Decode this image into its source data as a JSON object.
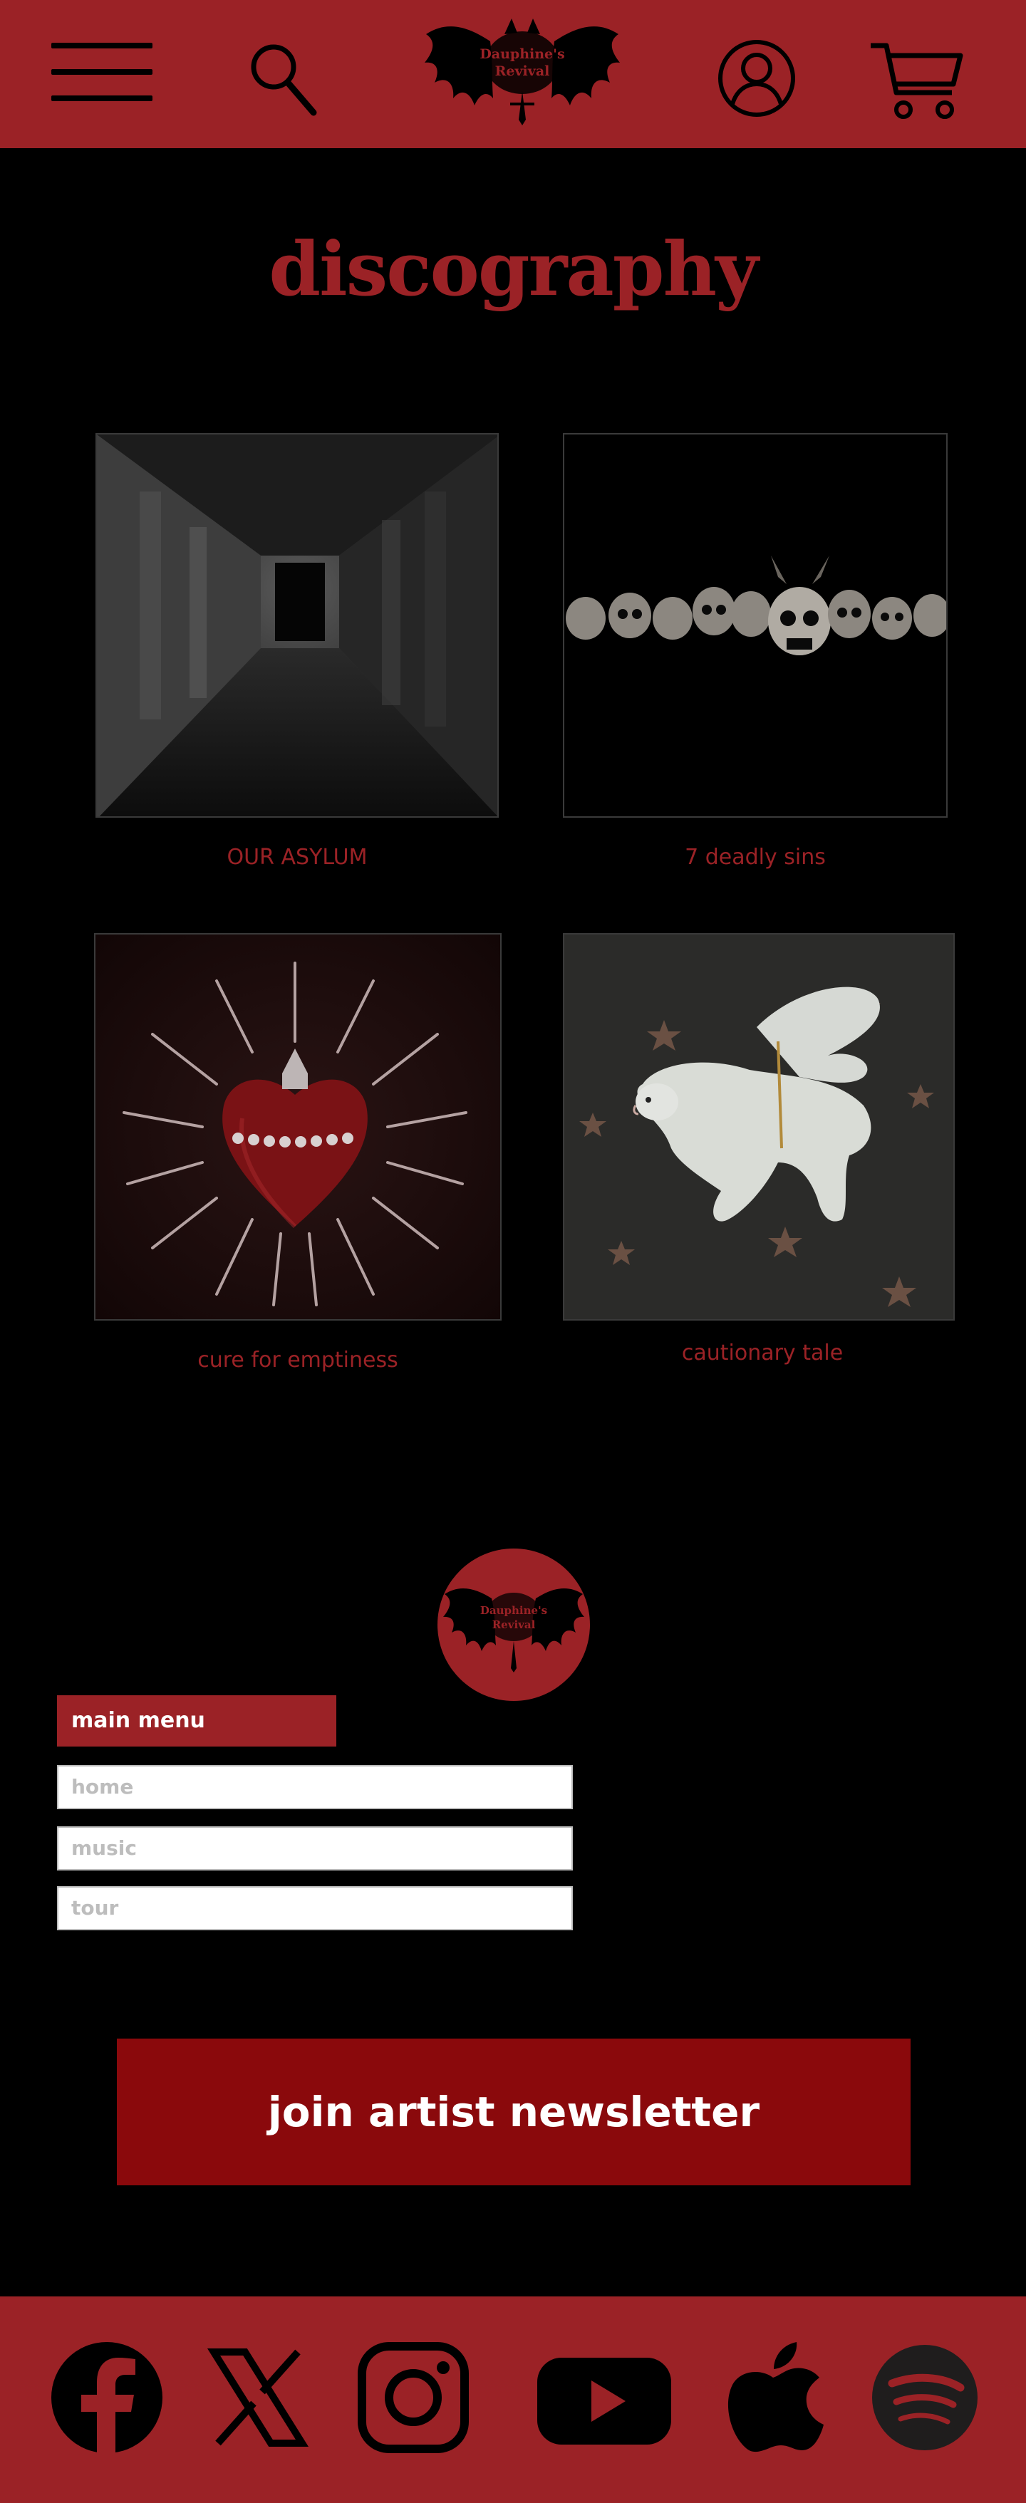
{
  "header": {
    "menu_icon": "hamburger-icon",
    "search_icon": "search-icon",
    "logo_text_line1": "Dauphine's",
    "logo_text_line2": "Revival",
    "account_icon": "account-icon",
    "cart_icon": "cart-icon"
  },
  "main": {
    "title": "discography",
    "albums": [
      {
        "title": "OUR ASYLUM"
      },
      {
        "title": "7 deadly sins"
      },
      {
        "title": "cure for emptiness"
      },
      {
        "title": "cautionary tale"
      }
    ]
  },
  "footer": {
    "logo_text_line1": "Dauphine's",
    "logo_text_line2": "Revival",
    "menu_header": "main menu",
    "menu_items": [
      {
        "label": "home"
      },
      {
        "label": "music"
      },
      {
        "label": "tour"
      }
    ],
    "newsletter_label": "join artist newsletter"
  },
  "social": {
    "icons": [
      "facebook-icon",
      "x-icon",
      "instagram-icon",
      "youtube-icon",
      "apple-icon",
      "spotify-icon"
    ]
  },
  "colors": {
    "brand_red": "#9b2226",
    "newsletter_red": "#8a090c",
    "background": "#000000"
  }
}
